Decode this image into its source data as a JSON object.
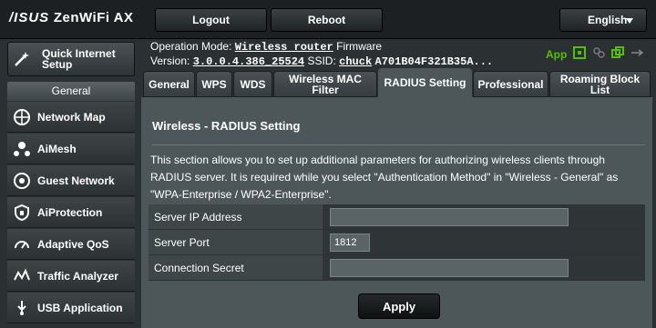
{
  "header": {
    "brand": "/ISUS",
    "product": "ZenWiFi AX",
    "logout_label": "Logout",
    "reboot_label": "Reboot",
    "language": "English"
  },
  "sidebar": {
    "quick_setup": "Quick Internet Setup",
    "general_header": "General",
    "items": [
      {
        "label": "Network Map",
        "icon": "network-map-icon"
      },
      {
        "label": "AiMesh",
        "icon": "aimesh-icon"
      },
      {
        "label": "Guest Network",
        "icon": "guest-network-icon"
      },
      {
        "label": "AiProtection",
        "icon": "aiprotection-icon"
      },
      {
        "label": "Adaptive QoS",
        "icon": "adaptive-qos-icon"
      },
      {
        "label": "Traffic Analyzer",
        "icon": "traffic-analyzer-icon"
      },
      {
        "label": "USB Application",
        "icon": "usb-application-icon"
      }
    ]
  },
  "status": {
    "mode_label": "Operation Mode:",
    "mode_value": "Wireless router",
    "firmware_label": "Firmware",
    "version_label": "Version:",
    "version_value": "3.0.0.4.386_25524",
    "ssid_label": "SSID:",
    "ssid_value": "chuck",
    "mac_value": "A701B04F321B35A...",
    "app_label": "App"
  },
  "tabs": [
    {
      "label": "General"
    },
    {
      "label": "WPS"
    },
    {
      "label": "WDS"
    },
    {
      "label": "Wireless MAC Filter"
    },
    {
      "label": "RADIUS Setting"
    },
    {
      "label": "Professional"
    },
    {
      "label": "Roaming Block List"
    }
  ],
  "panel": {
    "title": "Wireless - RADIUS Setting",
    "description": "This section allows you to set up additional parameters for authorizing wireless clients through RADIUS server. It is required while you select \"Authentication Method\" in \"Wireless - General\" as \"WPA-Enterprise / WPA2-Enterprise\".",
    "fields": [
      {
        "label": "Server IP Address",
        "value": ""
      },
      {
        "label": "Server Port",
        "value": "1812"
      },
      {
        "label": "Connection Secret",
        "value": ""
      }
    ],
    "apply_label": "Apply"
  },
  "colors": {
    "accent_green": "#55c000",
    "panel_bg": "#4d5659"
  }
}
